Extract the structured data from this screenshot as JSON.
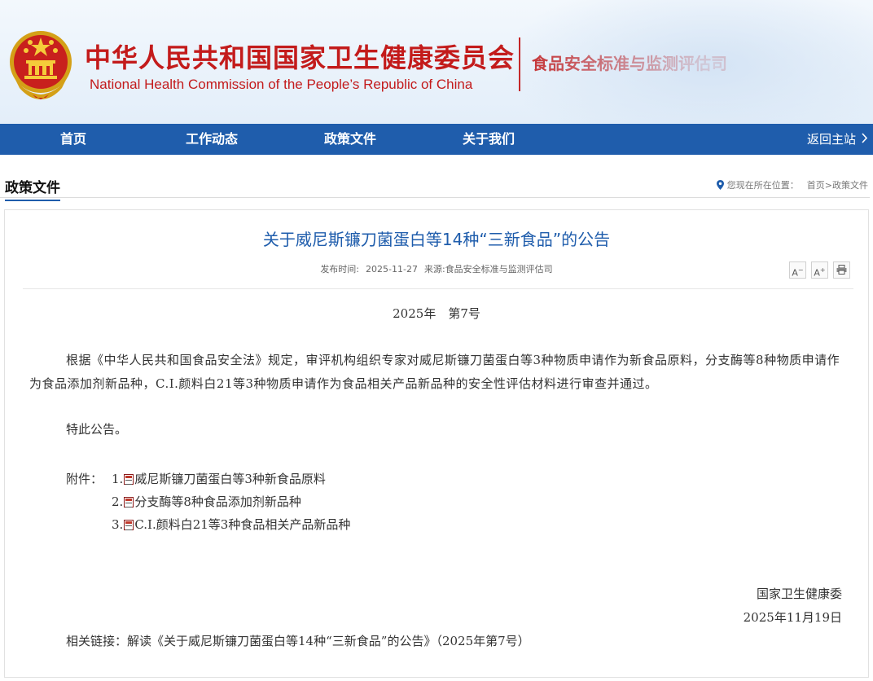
{
  "header": {
    "title_cn": "中华人民共和国国家卫生健康委员会",
    "title_en": "National Health Commission of the People’s  Republic of China",
    "dept_name": "食品安全标准与监测评估司",
    "brand_color": "#c31b1b"
  },
  "nav": {
    "items": [
      "首页",
      "工作动态",
      "政策文件",
      "关于我们"
    ],
    "return_label": "返回主站",
    "bg_color": "#1f5dac"
  },
  "section": {
    "title": "政策文件",
    "location_label": "您现在所在位置：",
    "crumb_home": "首页",
    "crumb_sep": ">",
    "crumb_current": "政策文件"
  },
  "article": {
    "title": "关于威尼斯镰刀菌蛋白等14种“三新食品”的公告",
    "publish_label": "发布时间:",
    "publish_date": "2025-11-27",
    "source_label": "来源:",
    "source": "食品安全标准与监测评估司",
    "tools": {
      "font_smaller": "A",
      "font_larger": "A",
      "print_icon": "printer-icon"
    },
    "doc_number": "2025年　第7号",
    "body": "根据《中华人民共和国食品安全法》规定，审评机构组织专家对威尼斯镰刀菌蛋白等3种物质申请作为新食品原料，分支酶等8种物质申请作为食品添加剂新品种，C.I.颜料白21等3种物质申请作为食品相关产品新品种的安全性评估材料进行审查并通过。",
    "notice": "特此公告。",
    "attachments_label": "附件：",
    "attachments": [
      {
        "num": "1.",
        "text": "威尼斯镰刀菌蛋白等3种新食品原料"
      },
      {
        "num": "2.",
        "text": "分支酶等8种食品添加剂新品种"
      },
      {
        "num": "3.",
        "text": "C.I.颜料白21等3种食品相关产品新品种"
      }
    ],
    "signature_org": "国家卫生健康委",
    "signature_date": "2025年11月19日",
    "related_label": "相关链接：",
    "related_link": "解读《关于威尼斯镰刀菌蛋白等14种“三新食品”的公告》（2025年第7号）"
  }
}
